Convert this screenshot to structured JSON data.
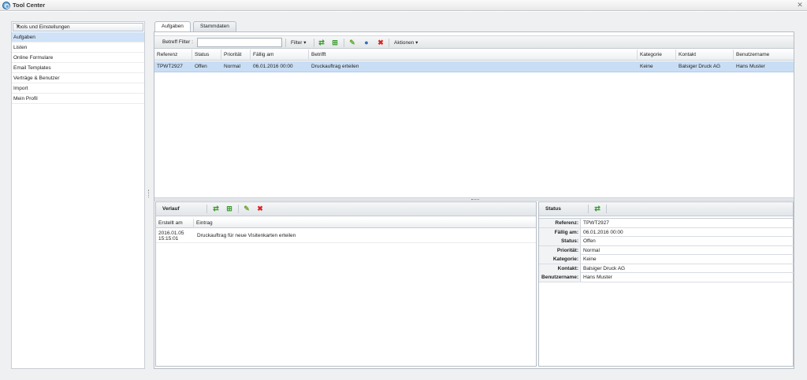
{
  "window": {
    "title": "Tool Center"
  },
  "sidebar": {
    "combo": "Tools und Einstellungen",
    "items": [
      {
        "label": "Aufgaben"
      },
      {
        "label": "Listen"
      },
      {
        "label": "Online Formulare"
      },
      {
        "label": "Email Templates"
      },
      {
        "label": "Verträge & Benutzer"
      },
      {
        "label": "Import"
      },
      {
        "label": "Mein Profil"
      }
    ]
  },
  "tabs": [
    {
      "label": "Aufgaben"
    },
    {
      "label": "Stammdaten"
    }
  ],
  "toolbar": {
    "filter_label": "Betreff Filter :",
    "filter_value": "",
    "filter_button": "Filter",
    "actions_button": "Aktionen"
  },
  "grid": {
    "columns": [
      "Referenz",
      "Status",
      "Priorität",
      "Fällig am",
      "Betrifft",
      "Kategorie",
      "Kontakt",
      "Benutzername"
    ],
    "rows": [
      [
        "TPWT2927",
        "Offen",
        "Normal",
        "06.01.2016 00:00",
        "Druckauftrag erteilen",
        "Keine",
        "Balsiger Druck AG",
        "Hans Muster"
      ]
    ]
  },
  "history": {
    "title": "Verlauf",
    "columns": [
      "Erstellt am",
      "Eintrag"
    ],
    "rows": [
      {
        "date": "2016.01.05 15:15:01",
        "entry": "Druckauftrag für neue Visitenkarten erteilen"
      }
    ]
  },
  "status_panel": {
    "title": "Status",
    "props": [
      {
        "key": "Referenz:",
        "value": "TPWT2927"
      },
      {
        "key": "Fällig am:",
        "value": "06.01.2016 00:00"
      },
      {
        "key": "Status:",
        "value": "Offen"
      },
      {
        "key": "Priorität:",
        "value": "Normal"
      },
      {
        "key": "Kategorie:",
        "value": "Keine"
      },
      {
        "key": "Kontakt:",
        "value": "Balsiger Druck AG"
      },
      {
        "key": "Benutzername:",
        "value": "Hans Muster"
      }
    ]
  },
  "icons": {
    "refresh": "refresh-icon",
    "add": "add-icon",
    "edit": "edit-icon",
    "user": "user-icon",
    "delete": "delete-icon"
  },
  "colors": {
    "selected_row": "#c9def5",
    "refresh": "#3a9a2a",
    "delete": "#d22"
  }
}
